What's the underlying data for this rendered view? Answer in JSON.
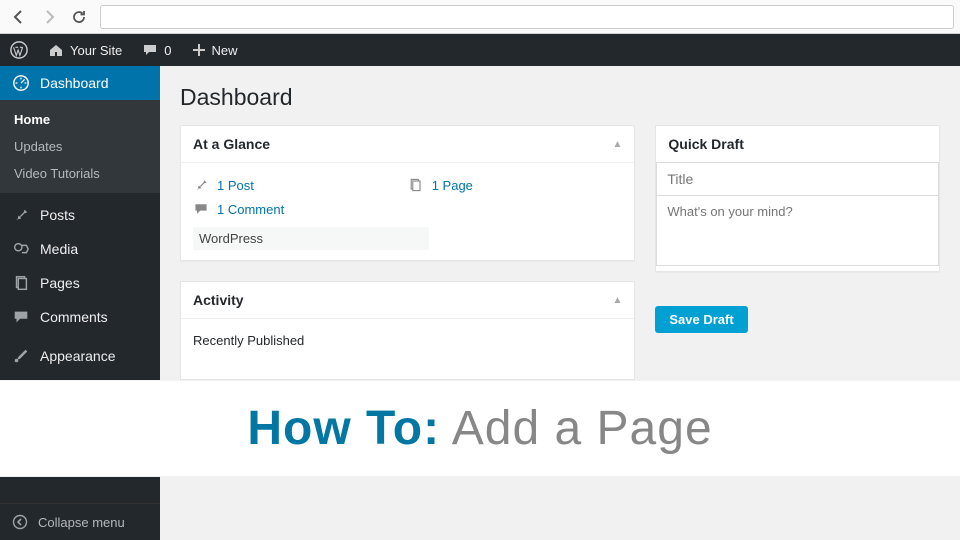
{
  "toolbar": {
    "site_name": "Your Site",
    "comment_count": "0",
    "new_label": "New"
  },
  "sidebar": {
    "items": [
      {
        "label": "Dashboard"
      },
      {
        "label": "Posts"
      },
      {
        "label": "Media"
      },
      {
        "label": "Pages"
      },
      {
        "label": "Comments"
      },
      {
        "label": "Appearance"
      }
    ],
    "submenu": [
      "Home",
      "Updates",
      "Video Tutorials"
    ],
    "collapse_label": "Collapse menu"
  },
  "main": {
    "page_title": "Dashboard",
    "glance": {
      "title": "At a Glance",
      "post_label": "1 Post",
      "page_label": "1 Page",
      "comment_label": "1 Comment",
      "version": "WordPress"
    },
    "activity": {
      "title": "Activity",
      "recent_label": "Recently Published"
    },
    "quick_draft": {
      "title": "Quick Draft",
      "title_placeholder": "Title",
      "content_placeholder": "What's on your mind?",
      "save_label": "Save Draft"
    }
  },
  "overlay": {
    "bold": "How To:",
    "light": " Add a Page"
  }
}
